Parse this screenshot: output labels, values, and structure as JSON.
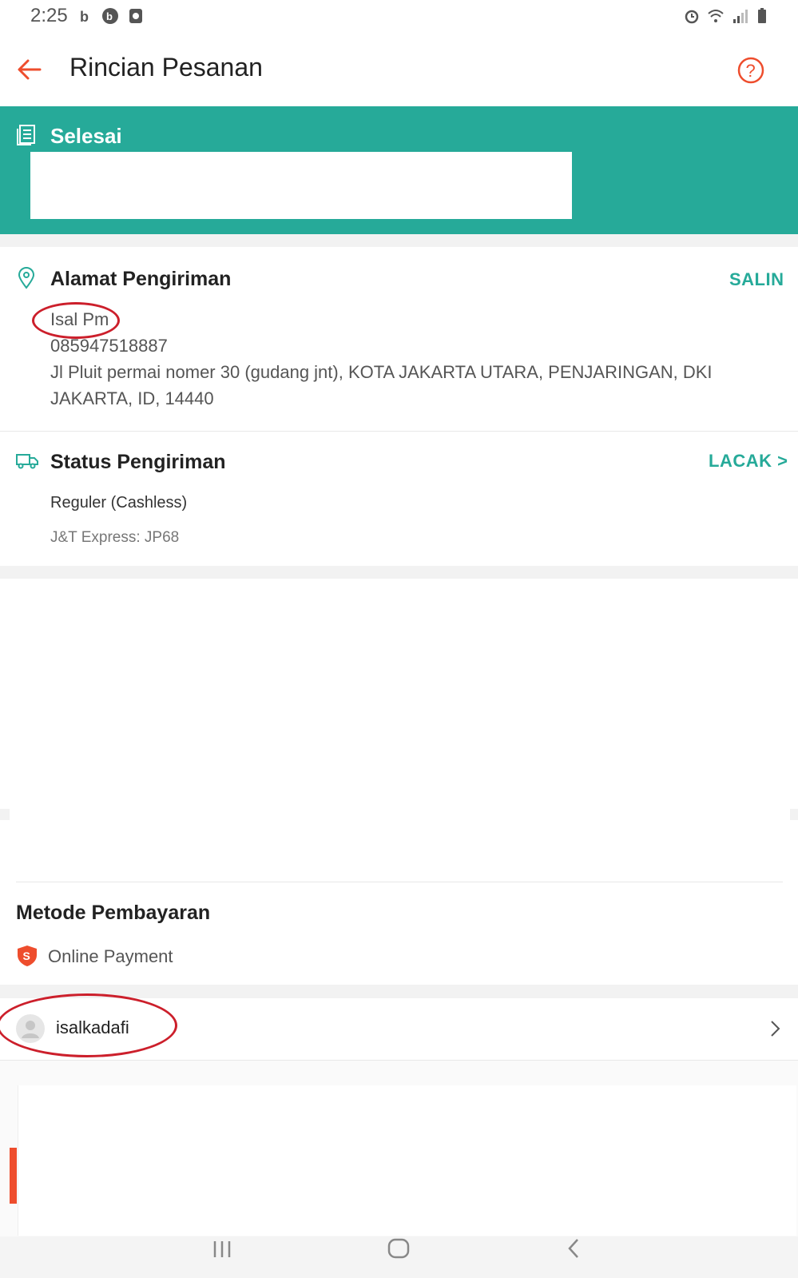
{
  "status_bar": {
    "time": "2:25"
  },
  "header": {
    "title": "Rincian Pesanan"
  },
  "order_status": {
    "label": "Selesai"
  },
  "shipping_address": {
    "title": "Alamat Pengiriman",
    "copy_label": "SALIN",
    "name": "Isal Pm",
    "phone": "085947518887",
    "address_line1": "Jl Pluit permai nomer 30 (gudang jnt), KOTA JAKARTA UTARA, PENJARINGAN, DKI",
    "address_line2": "JAKARTA, ID, 14440"
  },
  "shipping_status": {
    "title": "Status Pengiriman",
    "track_label": "LACAK >",
    "service": "Reguler (Cashless)",
    "courier": "J&T Express: JP68"
  },
  "payment": {
    "title": "Metode Pembayaran",
    "method": "Online Payment"
  },
  "seller": {
    "username": "isalkadafi"
  },
  "colors": {
    "accent": "#26aa99",
    "brand": "#ee4d2d",
    "annotation": "#cc1f2b"
  }
}
